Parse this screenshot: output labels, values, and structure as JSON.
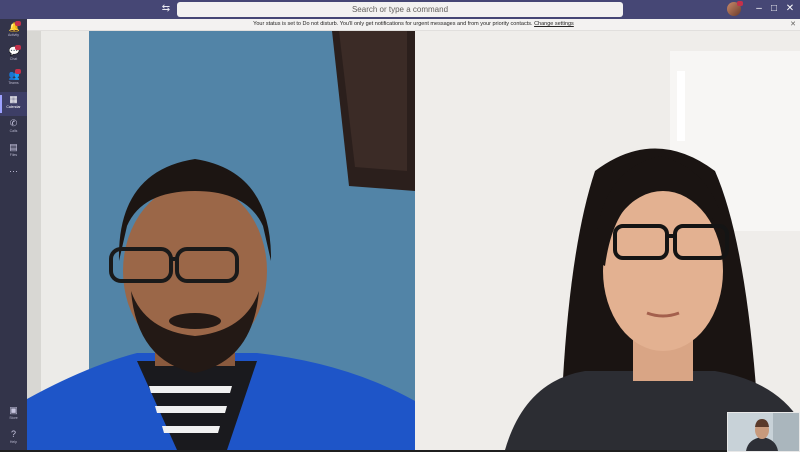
{
  "topbar": {
    "search_placeholder": "Search or type a command",
    "nav_icon": "back-forward-icon",
    "window_controls": {
      "minimize": "–",
      "maximize": "□",
      "close": "✕"
    }
  },
  "banner": {
    "text": "Your status is set to Do not disturb. You'll only get notifications for urgent messages and from your priority contacts.",
    "link": "Change settings",
    "close": "✕"
  },
  "rail": {
    "items": [
      {
        "label": "Activity",
        "icon": "bell-icon",
        "glyph": "🔔"
      },
      {
        "label": "Chat",
        "icon": "chat-icon",
        "glyph": "💬"
      },
      {
        "label": "Teams",
        "icon": "teams-icon",
        "glyph": "👥"
      },
      {
        "label": "Calendar",
        "icon": "calendar-icon",
        "glyph": "▦"
      },
      {
        "label": "Calls",
        "icon": "phone-icon",
        "glyph": "✆"
      },
      {
        "label": "Files",
        "icon": "file-icon",
        "glyph": "▤"
      },
      {
        "label": "",
        "icon": "more-icon",
        "glyph": "···"
      }
    ],
    "bottom": [
      {
        "label": "Store",
        "icon": "store-icon",
        "glyph": "▣"
      },
      {
        "label": "Help",
        "icon": "help-icon",
        "glyph": "?"
      }
    ]
  },
  "colors": {
    "topbar": "#464775",
    "rail": "#33344a",
    "accent": "#9ea2ff",
    "badge": "#c4314b"
  }
}
